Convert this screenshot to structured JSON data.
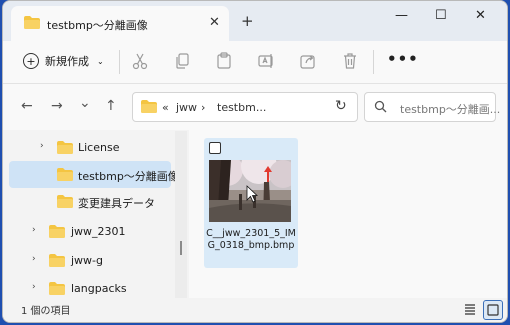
{
  "tab": {
    "title": "testbmp～分離画像",
    "close": "✕"
  },
  "window": {
    "new_tab": "+",
    "minimize": "—",
    "maximize": "☐",
    "close": "✕"
  },
  "toolbar": {
    "new_label": "新規作成",
    "more": "•••"
  },
  "nav": {
    "back": "←",
    "forward": "→",
    "recent": "⌄",
    "up": "↑"
  },
  "address": {
    "chevrons": "«",
    "segments": [
      "jww",
      "testbm..."
    ],
    "separator": "›",
    "refresh": "↻"
  },
  "search": {
    "placeholder": "testbmp～分離画..."
  },
  "sidebar": {
    "items": [
      {
        "label": "License",
        "arrow": "›"
      },
      {
        "label": "testbmp～分離画像",
        "arrow": ""
      },
      {
        "label": "変更建具データ",
        "arrow": ""
      },
      {
        "label": "jww_2301",
        "arrow": "›"
      },
      {
        "label": "jww-g",
        "arrow": "›"
      },
      {
        "label": "langpacks",
        "arrow": "›"
      }
    ]
  },
  "file": {
    "name": "C__jww_2301_5_IMG_0318_bmp.bmp"
  },
  "status": {
    "count": "1 個の項目"
  },
  "colors": {
    "folder": "#f4c542",
    "selected": "#cfe3f6",
    "accent": "#3b6fb8"
  }
}
